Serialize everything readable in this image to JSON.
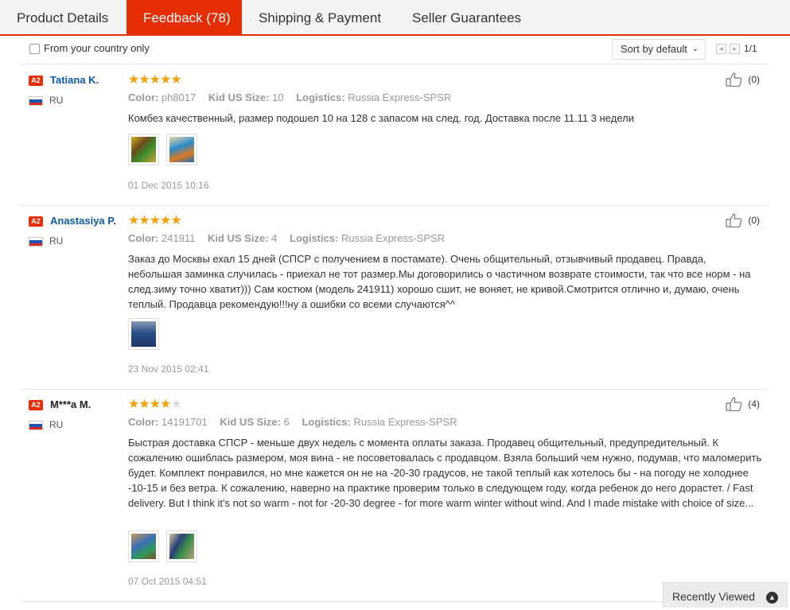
{
  "tabs": [
    {
      "label": "Product Details"
    },
    {
      "label": "Feedback (78)"
    },
    {
      "label": "Shipping & Payment"
    },
    {
      "label": "Seller Guarantees"
    }
  ],
  "filter": {
    "country_only_label": "From your country only",
    "sort_label": "Sort by default",
    "pager_text": "1/1"
  },
  "labels": {
    "color": "Color:",
    "size": "Kid US Size:",
    "logistics": "Logistics:"
  },
  "reviews": [
    {
      "badge": "A2",
      "name": "Tatiana K.",
      "country": "RU",
      "rating": 5,
      "color": "ph8017",
      "size": "10",
      "logistics": "Russia Express-SPSR",
      "text": "Комбез качественный, размер подошел 10 на 128 с запасом на след. год. Доставка после 11.11 3 недели",
      "date": "01 Dec 2015 10:16",
      "likes": "(0)"
    },
    {
      "badge": "A2",
      "name": "Anastasiya P.",
      "country": "RU",
      "rating": 5,
      "color": "241911",
      "size": "4",
      "logistics": "Russia Express-SPSR",
      "text": "Заказ до Москвы ехал 15 дней (СПСР с получением в постамате). Очень общительный, отзывчивый продавец. Правда, небольшая заминка случилась - приехал не тот размер.Мы договорились о частичном возврате стоимости, так что все норм - на след.зиму точно хватит))) Сам костюм (модель 241911) хорошо сшит, не воняет, не кривой.Смотрится отлично и, думаю, очень теплый. Продавца рекомендую!!!ну а ошибки со всеми случаются^^",
      "date": "23 Nov 2015 02:41",
      "likes": "(0)"
    },
    {
      "badge": "A2",
      "name": "M***a M.",
      "country": "RU",
      "rating": 4,
      "color": "14191701",
      "size": "6",
      "logistics": "Russia Express-SPSR",
      "text": "Быстрая доставка СПСР - меньше двух недель с момента оплаты заказа. Продавец общительный, предупредительный. К сожалению ошиблась размером, моя вина - не посоветовалась с продавцом. Взяла больший чем нужно, подумав, что маломерить будет. Комплект понравился, но мне кажется он не на -20-30 градусов, не такой теплый как хотелось бы - на погоду не холоднее -10-15 и без ветра. К сожалению, наверно на практике проверим только в следующем году, когда ребенок до него дорастет. / Fast delivery. But I think it's not so warm - not for -20-30 degree - for more warm winter without wind. And I made mistake with choice of size...",
      "date": "07 Oct 2015 04:51",
      "likes": "(4)"
    }
  ],
  "recently_viewed": "Recently Viewed",
  "colors": {
    "accent": "#e62e04",
    "star": "#f3a001",
    "link": "#0d5aa7"
  }
}
